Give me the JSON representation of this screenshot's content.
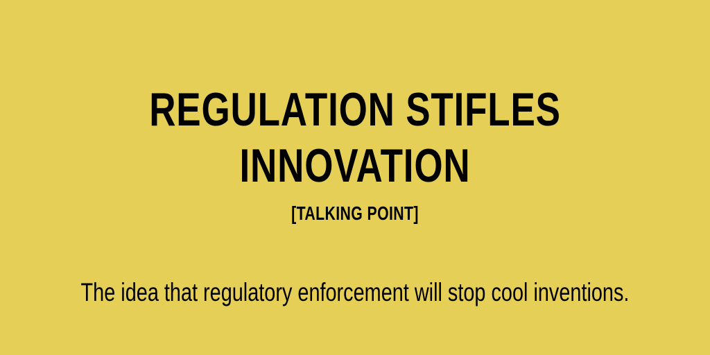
{
  "colors": {
    "background": "#e6cf57",
    "text": "#000000"
  },
  "headline": {
    "line1": "REGULATION STIFLES",
    "line2": "INNOVATION"
  },
  "tag": "[TALKING POINT]",
  "description": "The idea that regulatory enforcement will stop cool inventions."
}
